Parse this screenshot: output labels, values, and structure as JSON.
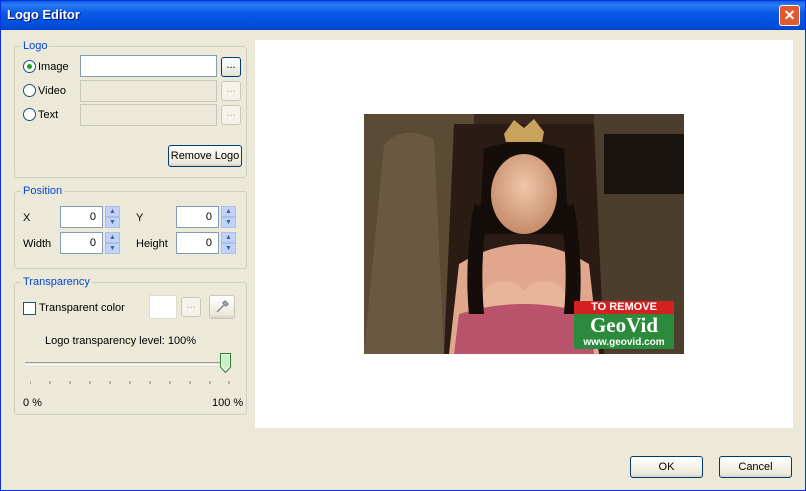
{
  "window": {
    "title": "Logo Editor"
  },
  "logo_group": {
    "label": "Logo",
    "options": [
      {
        "label": "Image",
        "checked": true
      },
      {
        "label": "Video",
        "checked": false
      },
      {
        "label": "Text",
        "checked": false
      }
    ],
    "browse_label": "...",
    "remove_button": "Remove Logo"
  },
  "position_group": {
    "label": "Position",
    "x_label": "X",
    "x_value": "0",
    "y_label": "Y",
    "y_value": "0",
    "width_label": "Width",
    "width_value": "0",
    "height_label": "Height",
    "height_value": "0"
  },
  "transparency_group": {
    "label": "Transparency",
    "transparent_color_label": "Transparent color",
    "browse_label": "...",
    "level_text": "Logo transparency level: 100%",
    "level": 1.0,
    "min_label": "0 %",
    "max_label": "100 %"
  },
  "watermark": {
    "line1": "TO REMOVE",
    "line2": "GeoVid",
    "line3": "www.geovid.com"
  },
  "buttons": {
    "ok": "OK",
    "cancel": "Cancel"
  }
}
